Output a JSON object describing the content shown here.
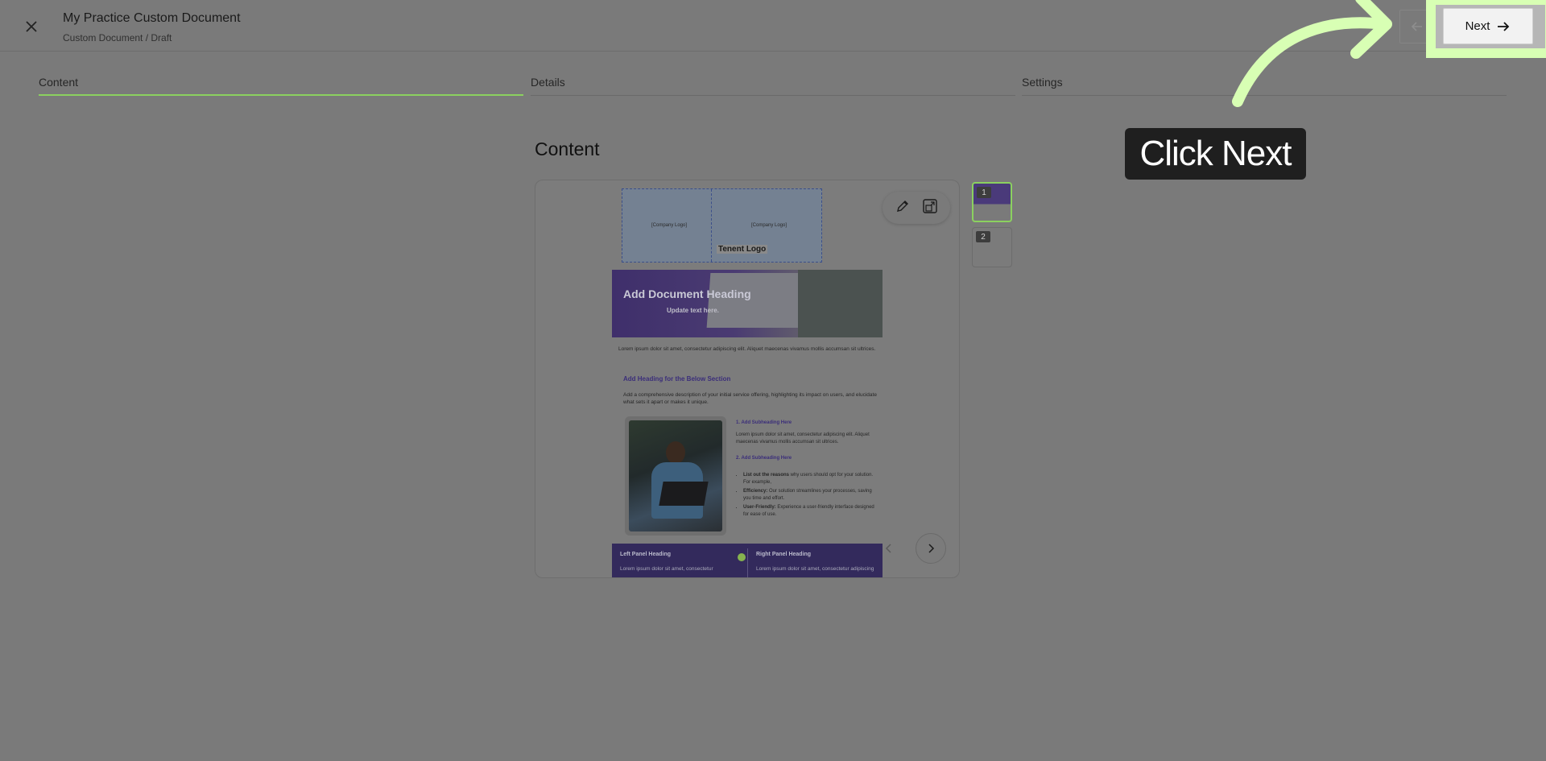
{
  "header": {
    "title": "My Practice Custom Document",
    "breadcrumb": "Custom Document / Draft",
    "next_label": "Next"
  },
  "steps": [
    {
      "label": "Content",
      "active": true
    },
    {
      "label": "Details",
      "active": false
    },
    {
      "label": "Settings",
      "active": false
    }
  ],
  "main": {
    "heading": "Content"
  },
  "preview": {
    "logo_placeholder_1": "[Company Logo]",
    "logo_placeholder_2": "[Company Logo]",
    "tenant_logo": "Tenent Logo",
    "banner_heading": "Add Document Heading",
    "banner_sub": "Update text here.",
    "intro": "Lorem ipsum dolor sit amet, consectetur adipiscing elit. Aliquet maecenas vivamus mollis accumsan sit ultrices.",
    "section_heading": "Add Heading for the Below Section",
    "section_desc": "Add a comprehensive description of your initial service offering, highlighting its impact on users, and elucidate what sets it apart or makes it unique.",
    "sub1_heading": "1. Add Subheading Here",
    "sub1_text": "Lorem ipsum dolor sit amet, consectetur adipiscing elit. Aliquet maecenas vivamus mollis accumsan sit ultrices.",
    "sub2_heading": "2. Add Subheading Here",
    "bullet1_bold": "List out the reasons",
    "bullet1_text": " why users should opt for your solution. For example,",
    "bullet2_bold": "Efficiency:",
    "bullet2_text": " Our solution streamlines your processes, saving you time and effort.",
    "bullet3_bold": "User-Friendly:",
    "bullet3_text": " Experience a user-friendly interface designed for ease of use.",
    "left_panel_heading": "Left Panel Heading",
    "left_panel_text": "Lorem ipsum dolor sit amet, consectetur",
    "right_panel_heading": "Right Panel Heading",
    "right_panel_text": "Lorem ipsum dolor sit amet, consectetur adipiscing"
  },
  "thumbnails": [
    {
      "number": "1",
      "active": true
    },
    {
      "number": "2",
      "active": false
    }
  ],
  "callout": {
    "text": "Click Next"
  },
  "colors": {
    "accent": "#8bd15f",
    "highlight": "#d8ffb4",
    "brand_purple": "#3f2f6b"
  }
}
